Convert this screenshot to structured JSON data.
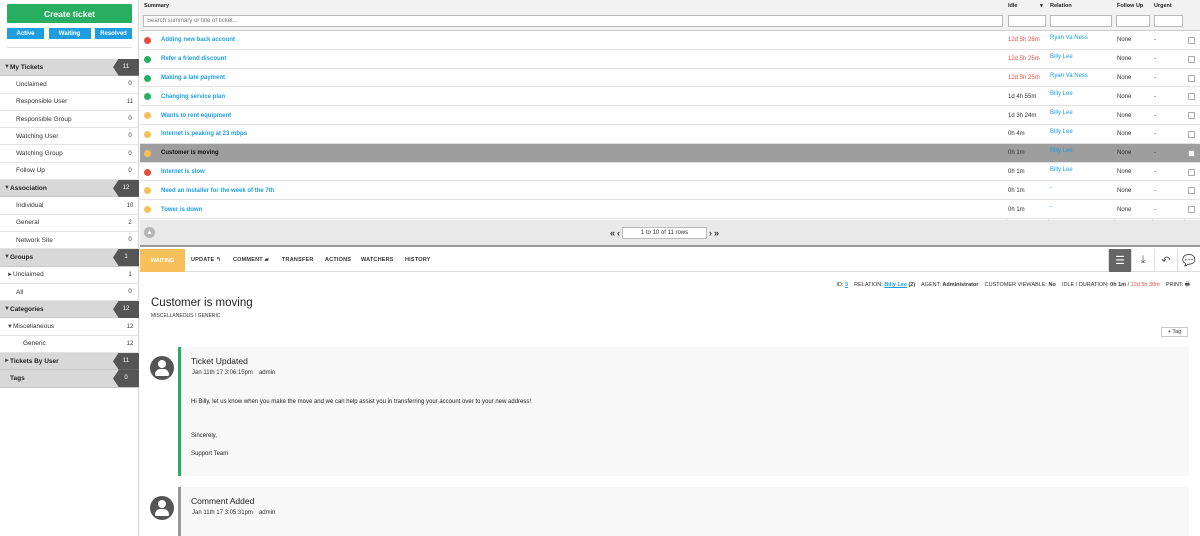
{
  "sidebar": {
    "create_label": "Create ticket",
    "status_buttons": [
      "Active",
      "Waiting",
      "Resolved"
    ],
    "nav": [
      {
        "type": "head",
        "label": "My Tickets",
        "count": "11",
        "caret": "▼"
      },
      {
        "type": "sub",
        "label": "Unclaimed",
        "count": "0"
      },
      {
        "type": "sub",
        "label": "Responsible User",
        "count": "11"
      },
      {
        "type": "sub",
        "label": "Responsible Group",
        "count": "0"
      },
      {
        "type": "sub",
        "label": "Watching User",
        "count": "0"
      },
      {
        "type": "sub",
        "label": "Watching Group",
        "count": "0"
      },
      {
        "type": "sub",
        "label": "Follow Up",
        "count": "0"
      },
      {
        "type": "head",
        "label": "Association",
        "count": "12",
        "caret": "▼"
      },
      {
        "type": "sub",
        "label": "Individual",
        "count": "10"
      },
      {
        "type": "sub",
        "label": "General",
        "count": "2"
      },
      {
        "type": "sub",
        "label": "Network Site",
        "count": "0"
      },
      {
        "type": "head",
        "label": "Groups",
        "count": "1",
        "caret": "▼"
      },
      {
        "type": "subc",
        "label": "Unclaimed",
        "count": "1",
        "caret": "►"
      },
      {
        "type": "sub",
        "label": "All",
        "count": "0"
      },
      {
        "type": "head",
        "label": "Categories",
        "count": "12",
        "caret": "▼"
      },
      {
        "type": "subc",
        "label": "Miscellaneous",
        "count": "12",
        "caret": "▼"
      },
      {
        "type": "sub2",
        "label": "Generic",
        "count": "12"
      },
      {
        "type": "head",
        "label": "Tickets By User",
        "count": "11",
        "caret": "►"
      },
      {
        "type": "head",
        "label": "Tags",
        "count": "0",
        "caret": ""
      }
    ]
  },
  "table": {
    "headers": {
      "summary": "Summary",
      "idle": "Idle",
      "idle_sort": "▾",
      "relation": "Relation",
      "follow_up": "Follow Up",
      "urgent": "Urgent"
    },
    "search_placeholder": "Search summary or title of ticket...",
    "rows": [
      {
        "status": "#e74c3c",
        "subject": "Adding new back account",
        "idle": "12d 5h 26m",
        "idle_red": true,
        "relation": "Ryan Va Ness",
        "follow_up": "None",
        "urgent": "-"
      },
      {
        "status": "#27ae60",
        "subject": "Refer a friend discount",
        "idle": "12d 5h 25m",
        "idle_red": true,
        "relation": "Billy Lee",
        "follow_up": "None",
        "urgent": "-"
      },
      {
        "status": "#27ae60",
        "subject": "Making a late payment",
        "idle": "12d 5h 25m",
        "idle_red": true,
        "relation": "Ryan Va Ness",
        "follow_up": "None",
        "urgent": "-"
      },
      {
        "status": "#27ae60",
        "subject": "Changing service plan",
        "idle": "1d 4h 55m",
        "idle_red": false,
        "relation": "Billy Lee",
        "follow_up": "None",
        "urgent": "-"
      },
      {
        "status": "#f8c05a",
        "subject": "Wants to rent equipment",
        "idle": "1d 3h 24m",
        "idle_red": false,
        "relation": "Billy Lee",
        "follow_up": "None",
        "urgent": "-"
      },
      {
        "status": "#f8c05a",
        "subject": "Internet is peaking at 23 mbps",
        "idle": "0h 4m",
        "idle_red": false,
        "relation": "Billy Lee",
        "follow_up": "None",
        "urgent": "-"
      },
      {
        "status": "#f8c05a",
        "subject": "Customer is moving",
        "idle": "0h 1m",
        "idle_red": false,
        "relation": "Billy Lee",
        "follow_up": "None",
        "urgent": "-",
        "selected": true
      },
      {
        "status": "#e74c3c",
        "subject": "Internet is slow",
        "idle": "0h 1m",
        "idle_red": false,
        "relation": "Billy Lee",
        "follow_up": "None",
        "urgent": "-"
      },
      {
        "status": "#f8c05a",
        "subject": "Need an installer for the week of the 7th",
        "idle": "0h 1m",
        "idle_red": false,
        "relation": "-",
        "follow_up": "None",
        "urgent": "-"
      },
      {
        "status": "#f8c05a",
        "subject": "Tower is down",
        "idle": "0h 1m",
        "idle_red": false,
        "relation": "-",
        "follow_up": "None",
        "urgent": "-"
      }
    ],
    "pager_text": "1 to 10 of 11 rows"
  },
  "detail": {
    "status_badge": "WAITING",
    "toolbar": [
      {
        "label": "UPDATE",
        "icon": "↰"
      },
      {
        "label": "COMMENT",
        "icon": "▰"
      },
      {
        "label": "TRANSFER",
        "icon": ""
      },
      {
        "label": "ACTIONS",
        "icon": ""
      },
      {
        "label": "WATCHERS",
        "icon": ""
      },
      {
        "label": "HISTORY",
        "icon": ""
      }
    ],
    "meta": {
      "id_label": "ID:",
      "id_value": "3",
      "relation_label": "RELATION:",
      "relation_value": "Billy Lee",
      "relation_count": "(2)",
      "agent_label": "AGENT:",
      "agent_value": "Administrator",
      "viewable_label": "CUSTOMER VIEWABLE:",
      "viewable_value": "No",
      "idle_label": "IDLE / DURATION:",
      "idle_value": "0h 1m",
      "duration_value": "12d 5h 30m",
      "print_label": "PRINT:"
    },
    "title": "Customer is moving",
    "category": "MISCELLANEOUS / GENERIC",
    "tag_label": "+ Tag",
    "entries": [
      {
        "title": "Ticket Updated",
        "date": "Jan 11th 17 3:06:15pm",
        "user": "admin",
        "body": [
          "Hi Billy, let us know when you make the move and we can help assist you in transferring your account over to your new address!",
          "Sincerely,",
          "Support Team"
        ]
      },
      {
        "title": "Comment Added",
        "date": "Jan 11th 17 3:05:31pm",
        "user": "admin",
        "body": []
      }
    ]
  },
  "colors": {
    "accent": "#1e9ee0",
    "create": "#27ae60",
    "waiting": "#f8c05a",
    "red": "#e74c3c"
  }
}
